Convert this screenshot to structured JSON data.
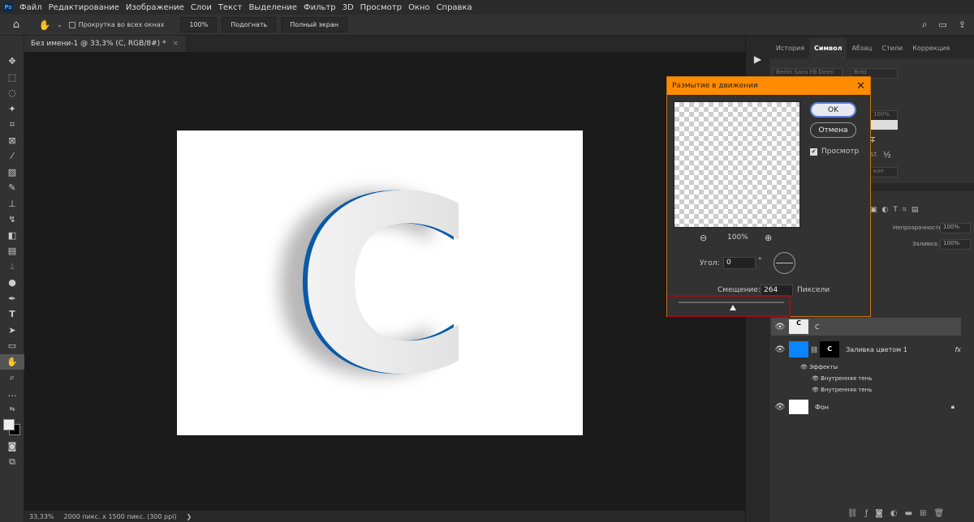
{
  "menu": [
    "Файл",
    "Редактирование",
    "Изображение",
    "Слои",
    "Текст",
    "Выделение",
    "Фильтр",
    "3D",
    "Просмотр",
    "Окно",
    "Справка"
  ],
  "options": {
    "scroll_all": "Прокрутка во всех окнах",
    "zoom": "100%",
    "fit": "Подогнать",
    "fullscreen": "Полный экран"
  },
  "doc_tab": {
    "title": "Без имени-1 @ 33,3% (C, RGB/8#) *",
    "close": "×"
  },
  "canvas": {
    "letter": "C",
    "fill": "#ffffff",
    "accent": "#0a5aa8"
  },
  "status": {
    "zoom": "33,33%",
    "size": "2000 пикс. x 1500 пикс. (300 ppi)",
    "arrow": "❯"
  },
  "panel_tabs": [
    "История",
    "Символ",
    "Абзац",
    "Стили",
    "Коррекция"
  ],
  "character": {
    "font": "Berlin Sans FB Demi",
    "style": "Bold",
    "percent": "100%",
    "fraction": "½",
    "st": "st",
    "aa": "кое"
  },
  "layers_panel": {
    "opacity_label": "Непрозрачность:",
    "opacity": "100%",
    "fill_label": "Заливка:",
    "fill": "100%",
    "layers": [
      {
        "name": "C"
      },
      {
        "name": "Заливка цветом 1",
        "fx": "fx",
        "color": "#0a84ff"
      },
      {
        "name": "Фон"
      }
    ],
    "effects_label": "Эффекты",
    "effects": [
      "Внутренняя тень",
      "Внутренняя тень"
    ]
  },
  "dialog": {
    "title": "Размытие в движении",
    "ok": "OK",
    "cancel": "Отмена",
    "preview_label": "Просмотр",
    "preview_checked": true,
    "zoom": "100%",
    "angle_label": "Угол:",
    "angle": "0",
    "degree": "°",
    "distance_label": "Смещение:",
    "distance": "264",
    "unit": "Пиксели",
    "title_color": "#ff8c00"
  }
}
